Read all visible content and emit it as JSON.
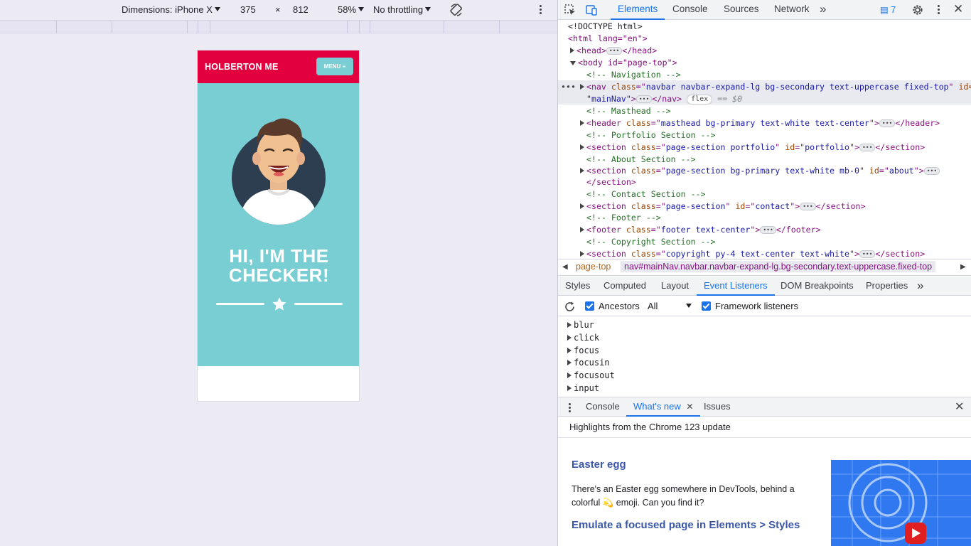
{
  "device_toolbar": {
    "dimensions_label": "Dimensions: iPhone X",
    "width": "375",
    "times": "×",
    "height": "812",
    "zoom": "58%",
    "throttling": "No throttling"
  },
  "phone": {
    "brand": "HOLBERTON ME",
    "menu_label": "MENU",
    "headline_line1": "HI, I'M THE",
    "headline_line2": "CHECKER!",
    "colors": {
      "navbar": "#e3003f",
      "masthead": "#78ced2"
    }
  },
  "devtools": {
    "tabs": [
      "Elements",
      "Console",
      "Sources",
      "Network"
    ],
    "more": "»",
    "issues_count": "7",
    "tree": {
      "doctype": "<!DOCTYPE html>",
      "html_open": "<html lang=\"en\">",
      "head": "<head>",
      "head_close": "</head>",
      "body_open": "<body id=\"page-top\">",
      "c_navigation": "<!-- Navigation -->",
      "nav_tag": "nav",
      "nav_class": "navbar navbar-expand-lg bg-secondary text-uppercase fixed-top",
      "nav_id_attr": "id=",
      "nav_id": "\"mainNav\"",
      "nav_close": "</nav>",
      "flex_badge": "flex",
      "dollar0": "== $0",
      "c_masthead": "<!-- Masthead -->",
      "header_class": "masthead bg-primary text-white text-center",
      "header_close": "</header>",
      "c_portfolio": "<!-- Portfolio Section -->",
      "portfolio_class": "page-section portfolio",
      "portfolio_id": "portfolio",
      "c_about": "<!-- About Section -->",
      "about_class": "page-section bg-primary text-white mb-0",
      "about_id": "about",
      "section_close": "</section>",
      "c_contact": "<!-- Contact Section -->",
      "contact_class": "page-section",
      "contact_id": "contact",
      "c_footer": "<!-- Footer -->",
      "footer_class": "footer text-center",
      "footer_close": "</footer>",
      "c_copyright": "<!-- Copyright Section -->",
      "copyright_class": "copyright py-4 text-center text-white"
    },
    "breadcrumb": {
      "page_top": "page-top",
      "nav": "nav#mainNav.navbar.navbar-expand-lg.bg-secondary.text-uppercase.fixed-top"
    },
    "sub_tabs": [
      "Styles",
      "Computed",
      "Layout",
      "Event Listeners",
      "DOM Breakpoints",
      "Properties"
    ],
    "listeners": {
      "ancestors": "Ancestors",
      "filter": "All",
      "framework": "Framework listeners",
      "events": [
        "blur",
        "click",
        "focus",
        "focusin",
        "focusout",
        "input"
      ]
    },
    "drawer": {
      "tabs": [
        "Console",
        "What's new",
        "Issues"
      ],
      "header": "Highlights from the Chrome 123 update",
      "title": "Easter egg",
      "body": "There's an Easter egg somewhere in DevTools, behind a colorful 💫 emoji. Can you find it?",
      "link": "Emulate a focused page in Elements > Styles"
    }
  }
}
